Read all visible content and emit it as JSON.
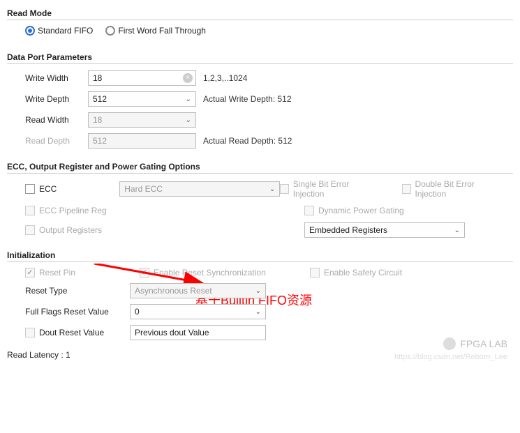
{
  "readMode": {
    "title": "Read Mode",
    "option1": "Standard FIFO",
    "option2": "First Word Fall Through",
    "selected": "Standard FIFO"
  },
  "dataPort": {
    "title": "Data Port Parameters",
    "writeWidth": {
      "label": "Write Width",
      "value": "18",
      "hint": "1,2,3,..1024"
    },
    "writeDepth": {
      "label": "Write Depth",
      "value": "512",
      "hint": "Actual Write Depth: 512"
    },
    "readWidth": {
      "label": "Read Width",
      "value": "18"
    },
    "readDepth": {
      "label": "Read Depth",
      "value": "512",
      "hint": "Actual Read Depth: 512"
    }
  },
  "ecc": {
    "title": "ECC, Output Register and Power Gating Options",
    "eccLabel": "ECC",
    "eccType": "Hard ECC",
    "singleBit": "Single Bit Error Injection",
    "doubleBit": "Double Bit Error Injection",
    "pipelineReg": "ECC Pipeline Reg",
    "dynPower": "Dynamic Power Gating",
    "outputRegs": "Output Registers",
    "embedded": "Embedded Registers"
  },
  "init": {
    "title": "Initialization",
    "resetPin": "Reset Pin",
    "enableSync": "Enable Reset Synchronization",
    "enableSafety": "Enable Safety Circuit",
    "resetType": {
      "label": "Reset Type",
      "value": "Asynchronous Reset"
    },
    "fullFlags": {
      "label": "Full Flags Reset Value",
      "value": "0"
    },
    "doutReset": {
      "label": "Dout Reset Value",
      "value": "Previous dout Value"
    }
  },
  "readLatency": "Read Latency : 1",
  "annotation": "基于Builtin FIFO资源",
  "watermark": {
    "brand": "FPGA LAB",
    "url": "https://blog.csdn.net/Reborn_Lee"
  }
}
